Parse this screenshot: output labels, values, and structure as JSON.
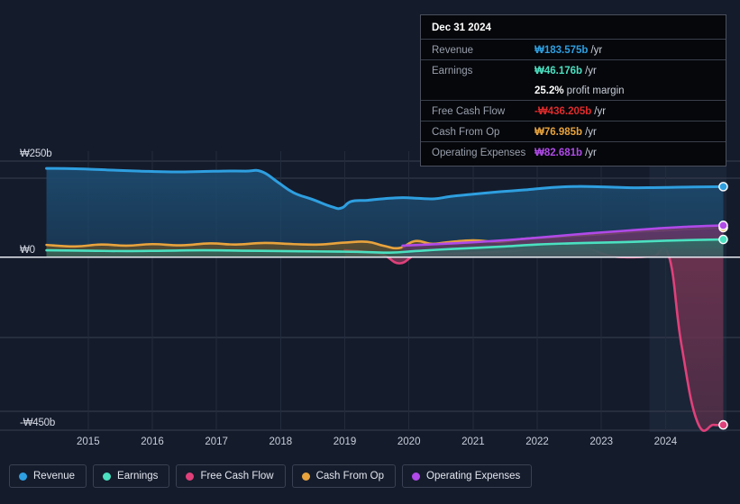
{
  "tooltip": {
    "date": "Dec 31 2024",
    "rows": [
      {
        "key": "Revenue",
        "value": "₩183.575b",
        "suffix": "/yr",
        "color": "#2e9fe0"
      },
      {
        "key": "Earnings",
        "value": "₩46.176b",
        "suffix": "/yr",
        "color": "#4be0c0"
      },
      {
        "key": "",
        "value": "25.2%",
        "suffix": "profit margin",
        "color": "#ffffff"
      },
      {
        "key": "Free Cash Flow",
        "value": "-₩436.205b",
        "suffix": "/yr",
        "color": "#e02b2b"
      },
      {
        "key": "Cash From Op",
        "value": "₩76.985b",
        "suffix": "/yr",
        "color": "#e8a33d"
      },
      {
        "key": "Operating Expenses",
        "value": "₩82.681b",
        "suffix": "/yr",
        "color": "#b04ae8"
      }
    ]
  },
  "legend": {
    "items": [
      {
        "label": "Revenue",
        "color": "#2e9fe0"
      },
      {
        "label": "Earnings",
        "color": "#4be0c0"
      },
      {
        "label": "Free Cash Flow",
        "color": "#e0407a"
      },
      {
        "label": "Cash From Op",
        "color": "#e8a33d"
      },
      {
        "label": "Operating Expenses",
        "color": "#b04ae8"
      }
    ]
  },
  "chart_data": {
    "type": "area",
    "title": "",
    "xlabel": "",
    "ylabel": "",
    "grid": true,
    "legend_position": "bottom",
    "ylim": [
      -450,
      250
    ],
    "y_ticks": [
      250,
      0,
      -450
    ],
    "y_tick_labels": [
      "₩250b",
      "₩0",
      "-₩450b"
    ],
    "xlim": [
      2014.3,
      2024.95
    ],
    "x_ticks": [
      2015,
      2016,
      2017,
      2018,
      2019,
      2020,
      2021,
      2022,
      2023,
      2024
    ],
    "x_tick_labels": [
      "2015",
      "2016",
      "2017",
      "2018",
      "2019",
      "2020",
      "2021",
      "2022",
      "2023",
      "2024"
    ],
    "forecast_band": {
      "start": 2023.75,
      "end": 2024.95
    },
    "series": [
      {
        "name": "Revenue",
        "color": "#2e9fe0",
        "fill": "#1d4a6e",
        "x": [
          2014.35,
          2014.8,
          2015.3,
          2015.8,
          2016.3,
          2016.8,
          2017.1,
          2017.45,
          2017.7,
          2017.95,
          2018.2,
          2018.5,
          2018.8,
          2018.95,
          2019.1,
          2019.35,
          2019.6,
          2019.9,
          2020.15,
          2020.4,
          2020.65,
          2021.0,
          2021.4,
          2021.8,
          2022.2,
          2022.6,
          2023.0,
          2023.4,
          2023.8,
          2024.2,
          2024.6,
          2024.9
        ],
        "y": [
          231,
          230,
          227,
          224,
          222,
          223,
          224,
          224,
          223,
          196,
          168,
          150,
          131,
          128,
          145,
          148,
          152,
          155,
          153,
          152,
          158,
          164,
          170,
          175,
          181,
          184,
          183,
          181,
          181,
          182,
          183,
          183.575
        ]
      },
      {
        "name": "Earnings",
        "color": "#4be0c0",
        "fill": "#2f6b64",
        "x": [
          2014.35,
          2015.0,
          2015.6,
          2016.2,
          2016.8,
          2017.4,
          2018.0,
          2018.6,
          2019.2,
          2019.7,
          2020.1,
          2020.5,
          2021.0,
          2021.5,
          2022.0,
          2022.5,
          2023.0,
          2023.5,
          2024.0,
          2024.5,
          2024.9
        ],
        "y": [
          18,
          17,
          16,
          17,
          18,
          17,
          16,
          15,
          14,
          12,
          16,
          20,
          24,
          28,
          33,
          36,
          38,
          40,
          43,
          45,
          46.176
        ]
      },
      {
        "name": "Cash From Op",
        "color": "#e8a33d",
        "fill": "#6b5326",
        "x": [
          2014.35,
          2014.8,
          2015.2,
          2015.6,
          2016.0,
          2016.45,
          2016.9,
          2017.3,
          2017.75,
          2018.2,
          2018.6,
          2019.0,
          2019.35,
          2019.6,
          2019.85,
          2020.1,
          2020.35,
          2020.6,
          2021.0,
          2021.4,
          2021.8,
          2022.2,
          2022.6,
          2023.0,
          2023.5,
          2024.0,
          2024.5,
          2024.9
        ],
        "y": [
          32,
          28,
          33,
          30,
          34,
          31,
          36,
          33,
          37,
          34,
          33,
          38,
          40,
          30,
          24,
          42,
          35,
          39,
          44,
          40,
          48,
          52,
          56,
          60,
          66,
          70,
          74,
          76.985
        ]
      },
      {
        "name": "Operating Expenses",
        "color": "#b04ae8",
        "fill": "#5a3270",
        "x": [
          2019.9,
          2020.3,
          2020.8,
          2021.3,
          2021.8,
          2022.3,
          2022.8,
          2023.3,
          2023.8,
          2024.3,
          2024.9
        ],
        "y": [
          30,
          33,
          37,
          42,
          48,
          55,
          62,
          68,
          74,
          79,
          82.681
        ]
      },
      {
        "name": "Free Cash Flow",
        "color": "#e0407a",
        "fill": "#6e3350",
        "x": [
          2019.0,
          2019.3,
          2019.6,
          2019.85,
          2020.1,
          2020.4,
          2020.8,
          2021.2,
          2021.6,
          2022.0,
          2022.4,
          2022.8,
          2023.1,
          2023.4,
          2023.8,
          2024.05,
          2024.25,
          2024.5,
          2024.75,
          2024.9
        ],
        "y": [
          18,
          14,
          6,
          -16,
          5,
          8,
          10,
          13,
          16,
          22,
          26,
          22,
          5,
          0,
          2,
          4,
          -230,
          -430,
          -436,
          -436.205
        ]
      }
    ]
  }
}
